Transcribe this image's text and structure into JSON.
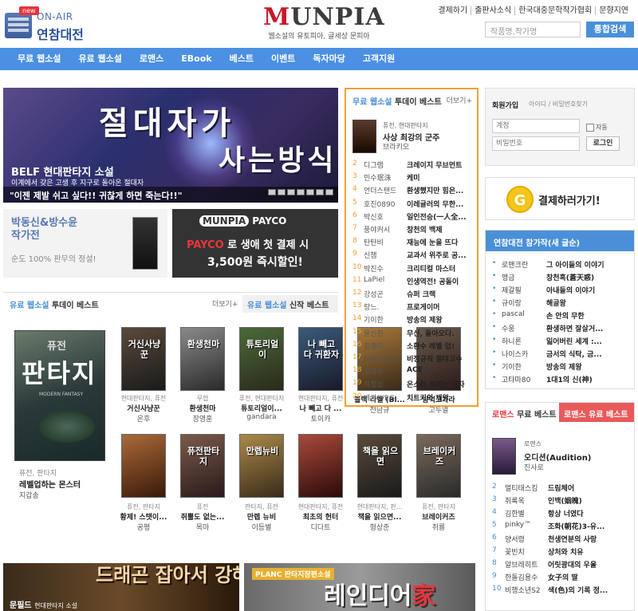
{
  "header": {
    "onair_badge": "new",
    "onair_line1": "ON-AIR",
    "onair_line2": "연참대전",
    "logo": "MUNPIA",
    "logo_tag": "웹소설의 유토피아, 글세상 문피아",
    "top_links": [
      "결제하기",
      "출판사소식",
      "한국대중문학작가협회",
      "문향지연"
    ],
    "search_placeholder": "작품명,작가명",
    "search_button": "통합검색"
  },
  "nav": [
    "무료 웹소설",
    "유료 웹소설",
    "로맨스",
    "EBook",
    "베스트",
    "이벤트",
    "독자마당",
    "고객지원"
  ],
  "banners": {
    "main_big1": "절대자가",
    "main_big2": "사는방식",
    "main_label": "BELF 현대판타지 소설",
    "main_sub": "이계에서 갖은 고생 후 지구로 돌아온 절대자",
    "main_quote": "\"이젠 제발 쉬고 싶다!! 귀찮게 하면 죽는다!!\"",
    "b2_title1": "박동신&방수윤",
    "b2_title2": "작가전",
    "b2_sub": "순도 100% 판무의 정설!",
    "b3_logo1": "MUNPIA",
    "b3_logo2": "PAYCO",
    "b3_line1a": "PAYCO",
    "b3_line1b": " 로 생애 첫 결제 시",
    "b3_line2": "3,500원 즉시할인!",
    "bottom1_title": "드래곤 잡아서 강해진 남자",
    "bottom1_author": "문필드",
    "bottom1_genre": "현대판타지 소설",
    "bottom2_tag": "PLANC 판타지장편소설",
    "bottom2_title_a": "레인디어",
    "bottom2_title_b": "家"
  },
  "best": {
    "tab1_a": "유료 웹소설",
    "tab1_b": " 투데이 베스트",
    "more": "더보기+",
    "tab2_a": "유료 웹소설",
    "tab2_b": " 신작 베스트",
    "feature": {
      "cover_top": "퓨전",
      "cover_title": "판타지",
      "cover_en": "MODERN FANTASY",
      "genre": "퓨전, 판타지",
      "title": "레벨업하는 몬스터",
      "author": "지갑송"
    },
    "row1": [
      {
        "genre": "현대판타지, 퓨전",
        "title": "거신사냥꾼",
        "author": "온후",
        "cover": "거신사냥꾼",
        "c1": "#5a4a3a",
        "c2": "#1a1a1a"
      },
      {
        "genre": "무협",
        "title": "환생천마",
        "author": "장영훈",
        "cover": "환생천마",
        "c1": "#8a8a8a",
        "c2": "#2a2a2a"
      },
      {
        "genre": "퓨전, 현대판타지",
        "title": "튜토리얼이...",
        "author": "gandara",
        "cover": "튜토리얼이",
        "c1": "#4a6a3a",
        "c2": "#2a2a1a"
      },
      {
        "genre": "현대판타지, 퓨전",
        "title": "나 빼고 다 ...",
        "author": "토이카",
        "cover": "나 빼고 다 귀환자",
        "c1": "#3a5a7a",
        "c2": "#1a1a2a"
      },
      {
        "genre": "",
        "title": "블랙 라벨 (Bl...",
        "author": "전남규",
        "cover": "",
        "c1": "#aa7a3a",
        "c2": "#3a2a1a"
      },
      {
        "genre": "",
        "title": "밤먹고가라",
        "author": "고두열",
        "cover": "",
        "c1": "#6a5a4a",
        "c2": "#2a1a1a"
      }
    ],
    "row2": [
      {
        "genre": "퓨전, 판타지",
        "title": "황제! 스탯이...",
        "author": "공평",
        "cover": "",
        "c1": "#aa6a3a",
        "c2": "#3a1a0a"
      },
      {
        "genre": "퓨전",
        "title": "쥐뿔도 없는...",
        "author": "목마",
        "cover": "퓨전판타지",
        "c1": "#7a5a4a",
        "c2": "#2a1a1a"
      },
      {
        "genre": "판타지, 퓨전",
        "title": "만렙 뉴비",
        "author": "이등별",
        "cover": "만렙뉴비",
        "c1": "#aa8a4a",
        "c2": "#3a2a1a"
      },
      {
        "genre": "현대판타지, 퓨전",
        "title": "최초의 헌터",
        "author": "디다트",
        "cover": "",
        "c1": "#aa4a3a",
        "c2": "#2a0a0a"
      },
      {
        "genre": "현대판타지, 판...",
        "title": "책을 읽으면...",
        "author": "형상준",
        "cover": "책을 읽으면",
        "c1": "#5a4a3a",
        "c2": "#1a1a1a"
      },
      {
        "genre": "퓨전, 판타지",
        "title": "브레이커즈",
        "author": "취룡",
        "cover": "브레이커즈",
        "c1": "#7a6a5a",
        "c2": "#2a2a2a"
      }
    ]
  },
  "today": {
    "head_a": "무료 웹소설",
    "head_b": " 투데이 베스트",
    "more": "더보기+",
    "top": {
      "genre": "퓨전, 현대판타지",
      "title": "사상 최강의 군주",
      "author": "브라키오"
    },
    "list": [
      {
        "n": "2",
        "author": "디그램",
        "title": "크레이지 무브먼트"
      },
      {
        "n": "3",
        "author": "민수珉洙",
        "title": "케미"
      },
      {
        "n": "4",
        "author": "언더스탠드",
        "title": "환생했지만 힘은..."
      },
      {
        "n": "5",
        "author": "호진0890",
        "title": "이레귤러의 무한..."
      },
      {
        "n": "6",
        "author": "박신호",
        "title": "일인전승(一人全..."
      },
      {
        "n": "7",
        "author": "풍야커시",
        "title": "창천의 백제"
      },
      {
        "n": "8",
        "author": "탄탄비",
        "title": "재능에 눈을 뜨다"
      },
      {
        "n": "9",
        "author": "신챔",
        "title": "교과서 위주로 공..."
      },
      {
        "n": "10",
        "author": "박진수",
        "title": "크리티컬 마스터"
      },
      {
        "n": "11",
        "author": "LaPiel",
        "title": "인생역전! 공돌이"
      },
      {
        "n": "12",
        "author": "강성곤",
        "title": "슈퍼 크랙"
      },
      {
        "n": "13",
        "author": "랑느.",
        "title": "프로게이머"
      },
      {
        "n": "14",
        "author": "기이한",
        "title": "방송의 제왕"
      },
      {
        "n": "15",
        "author": "윤신현",
        "title": "무신, 돌아오다."
      },
      {
        "n": "16",
        "author": "힘펠이",
        "title": "소환수 레벨 업!"
      },
      {
        "n": "17",
        "author": "하늘땅사이",
        "title": "비정규직 절대고수"
      },
      {
        "n": "18",
        "author": "김갑주",
        "title": "ACE"
      },
      {
        "n": "19",
        "author": "혀정상",
        "title": "온스터 부리는 남자"
      },
      {
        "n": "20",
        "author": "베가(VEGA)",
        "title": "치트키의 제왕"
      }
    ]
  },
  "login": {
    "join": "회원가입",
    "find": "아이디 / 비밀번호찾기",
    "id_placeholder": "계정",
    "pw_placeholder": "비밀번호",
    "auto": "자동",
    "button": "로그인"
  },
  "pay": {
    "icon": "G",
    "label": "결제하러가기!"
  },
  "participants": {
    "head": "연참대전 참가작(새 글순)",
    "list": [
      {
        "author": "로맨크란",
        "title": "그 아이들의 이야기"
      },
      {
        "author": "맹금",
        "title": "창천혹(蒼天惑)"
      },
      {
        "author": "제갈필",
        "title": "아내들의 이야기"
      },
      {
        "author": "규이랑",
        "title": "해골왕"
      },
      {
        "author": "pascal",
        "title": "손 안의 무한"
      },
      {
        "author": "수웅",
        "title": "환생하면 잘살거..."
      },
      {
        "author": "하니론",
        "title": "잃어버린 세계 :..."
      },
      {
        "author": "나이스카",
        "title": "금서의 식탁, 금..."
      },
      {
        "author": "기이한",
        "title": "방송의 제왕"
      },
      {
        "author": "고타마80",
        "title": "1대1의 신(神)"
      }
    ]
  },
  "romance": {
    "tab1_a": "로맨스",
    "tab1_b": " 무료 베스트",
    "tab2": "로맨스 유료 베스트",
    "top": {
      "genre": "로맨스",
      "title": "오디션(Audition)",
      "author": "진사로"
    },
    "list": [
      {
        "n": "2",
        "author": "멀티태스킹",
        "title": "드림체어"
      },
      {
        "n": "3",
        "author": "취록옥",
        "title": "인백(姻魄)"
      },
      {
        "n": "4",
        "author": "김한별",
        "title": "항상 너였다"
      },
      {
        "n": "5",
        "author": "pinky™",
        "title": "조화(朝花)3-유..."
      },
      {
        "n": "6",
        "author": "양서령",
        "title": "천생연분의 사랑"
      },
      {
        "n": "7",
        "author": "꽃빈치",
        "title": "상처와 치유"
      },
      {
        "n": "8",
        "author": "알브레히트",
        "title": "어릿광대의 우울"
      },
      {
        "n": "9",
        "author": "한돌김용수",
        "title": "女子의 딸"
      },
      {
        "n": "10",
        "author": "비행소년S2",
        "title": "색(色)의 기록 정..."
      }
    ]
  },
  "colors": {
    "nav": "#4b90e3",
    "accent_orange": "#f0a030",
    "accent_red": "#e8353b",
    "link_blue": "#4a90d9"
  }
}
